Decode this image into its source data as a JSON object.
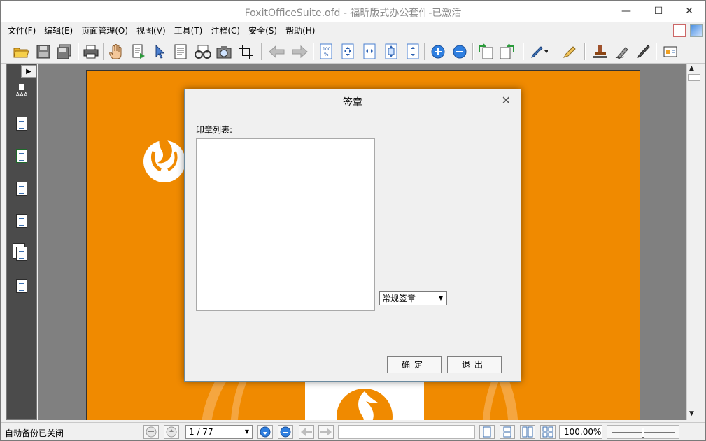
{
  "window": {
    "title": "FoxitOfficeSuite.ofd - 福昕版式办公套件-已激活",
    "minimize_icon": "minimize-icon",
    "maximize_icon": "maximize-icon",
    "close_icon": "close-icon",
    "min_glyph": "—",
    "max_glyph": "☐",
    "close_glyph": "✕"
  },
  "menu": {
    "items": [
      {
        "label": "文件(F)"
      },
      {
        "label": "编辑(E)"
      },
      {
        "label": "页面管理(O)"
      },
      {
        "label": "视图(V)"
      },
      {
        "label": "工具(T)"
      },
      {
        "label": "注释(C)"
      },
      {
        "label": "安全(S)"
      },
      {
        "label": "帮助(H)"
      }
    ]
  },
  "toolbar": {
    "icons": [
      "open-folder-icon",
      "save-icon",
      "save-as-icon",
      "print-icon",
      "hand-tool-icon",
      "select-text-icon",
      "pointer-icon",
      "text-select-icon",
      "glasses-icon",
      "camera-snapshot-icon",
      "crop-icon",
      "back-arrow-icon",
      "forward-arrow-icon",
      "actual-size-icon",
      "fit-page-icon",
      "fit-width-icon",
      "fit-visible-icon",
      "fit-height-icon",
      "zoom-in-icon",
      "zoom-out-icon",
      "rotate-left-icon",
      "rotate-right-icon",
      "pen-icon",
      "highlighter-icon",
      "stamp-icon",
      "sign-icon",
      "brush-icon",
      "properties-icon"
    ]
  },
  "leftpanel": {
    "expand_glyph": "▶",
    "thumb_label": "AAA",
    "icons": [
      "thumbnails-icon",
      "pages-icon",
      "bookmarks-icon",
      "outline-icon",
      "attachments-icon",
      "layers-icon",
      "annotations-icon"
    ]
  },
  "statusbar": {
    "autosave_text": "自动备份已关闭",
    "page_value": "1 / 77",
    "zoom_value": "100.00%",
    "zoom_level": 0.5
  },
  "dialog": {
    "title": "签章",
    "close_glyph": "✕",
    "list_label": "印章列表:",
    "seal_type_value": "常规签章",
    "ok_label": "确定",
    "exit_label": "退出"
  },
  "colors": {
    "page_orange": "#f08a00",
    "panel_dark": "#4b4b4b",
    "canvas_gray": "#808080"
  }
}
